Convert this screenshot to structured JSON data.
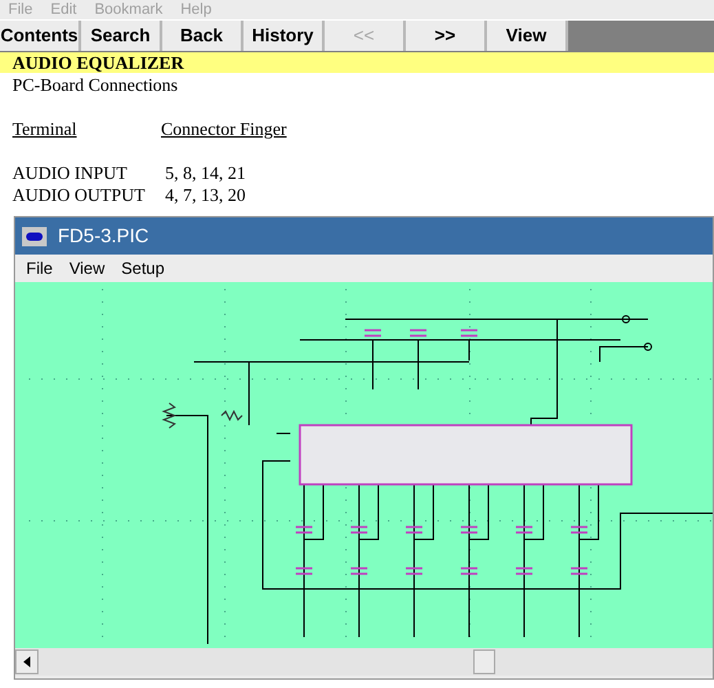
{
  "menu": [
    "File",
    "Edit",
    "Bookmark",
    "Help"
  ],
  "buttons": [
    {
      "label": "Contents",
      "disabled": false
    },
    {
      "label": "Search",
      "disabled": false
    },
    {
      "label": "Back",
      "disabled": false
    },
    {
      "label": "History",
      "disabled": false
    },
    {
      "label": "<<",
      "disabled": true
    },
    {
      "label": ">>",
      "disabled": false
    },
    {
      "label": "View",
      "disabled": false
    }
  ],
  "topic": {
    "title": "AUDIO EQUALIZER",
    "subtitle": "PC-Board Connections",
    "columns": [
      "Terminal",
      "Connector Finger"
    ],
    "rows": [
      [
        "AUDIO INPUT",
        "5, 8, 14, 21"
      ],
      [
        "AUDIO OUTPUT",
        "4, 7, 13, 20"
      ]
    ]
  },
  "viewer": {
    "title": "FD5-3.PIC",
    "menu": [
      "File",
      "View",
      "Setup"
    ]
  }
}
